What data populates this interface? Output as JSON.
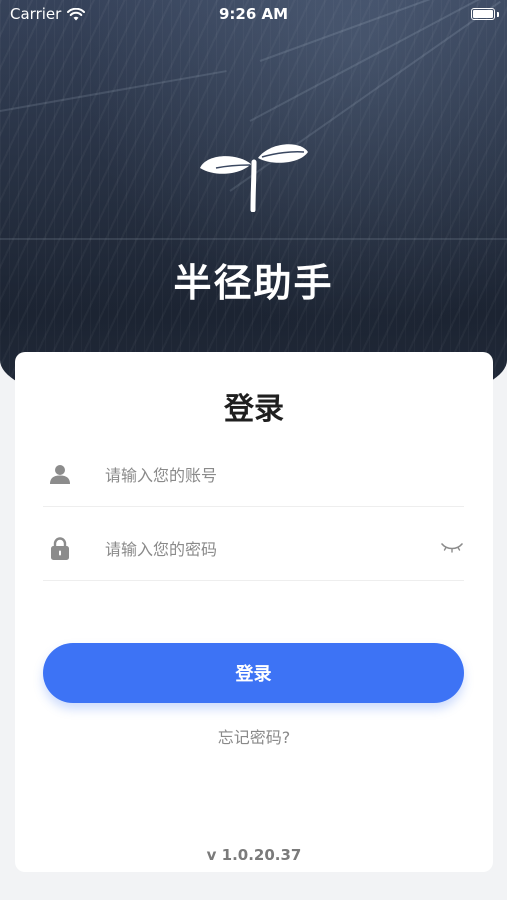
{
  "status_bar": {
    "carrier": "Carrier",
    "time": "9:26 AM"
  },
  "app": {
    "title": "半径助手",
    "logo_icon": "sprout-icon"
  },
  "login_card": {
    "title": "登录",
    "account_field": {
      "icon": "user-icon",
      "placeholder": "请输入您的账号",
      "value": ""
    },
    "password_field": {
      "icon": "lock-icon",
      "placeholder": "请输入您的密码",
      "value": "",
      "toggle_icon": "eye-closed-icon"
    },
    "login_button_label": "登录",
    "forgot_password_label": "忘记密码?",
    "version": "v 1.0.20.37"
  },
  "colors": {
    "accent": "#3d73f5",
    "card": "#ffffff",
    "page_bg": "#f2f3f5",
    "hint_text": "#8a8a8a"
  }
}
